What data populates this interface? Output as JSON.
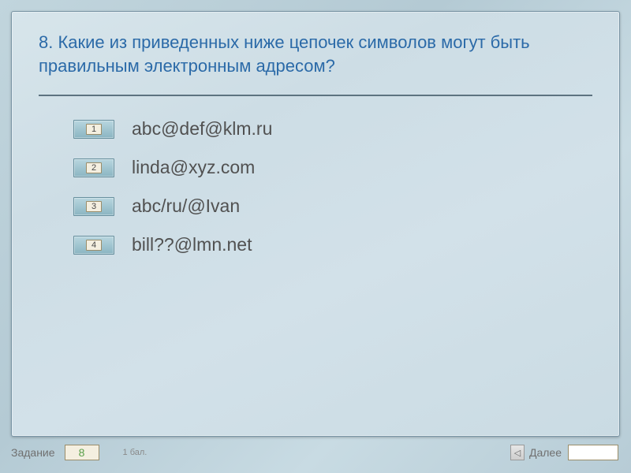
{
  "question": "8. Какие из приведенных ниже цепочек символов могут быть правильным электронным адресом?",
  "options": [
    {
      "num": "1",
      "text": "abc@def@klm.ru"
    },
    {
      "num": "2",
      "text": "linda@xyz.com"
    },
    {
      "num": "3",
      "text": "abc/ru/@Ivan"
    },
    {
      "num": "4",
      "text": "bill??@lmn.net"
    }
  ],
  "footer": {
    "task_label": "Задание",
    "task_number": "8",
    "points": "1 бал.",
    "next_label": "Далее"
  }
}
